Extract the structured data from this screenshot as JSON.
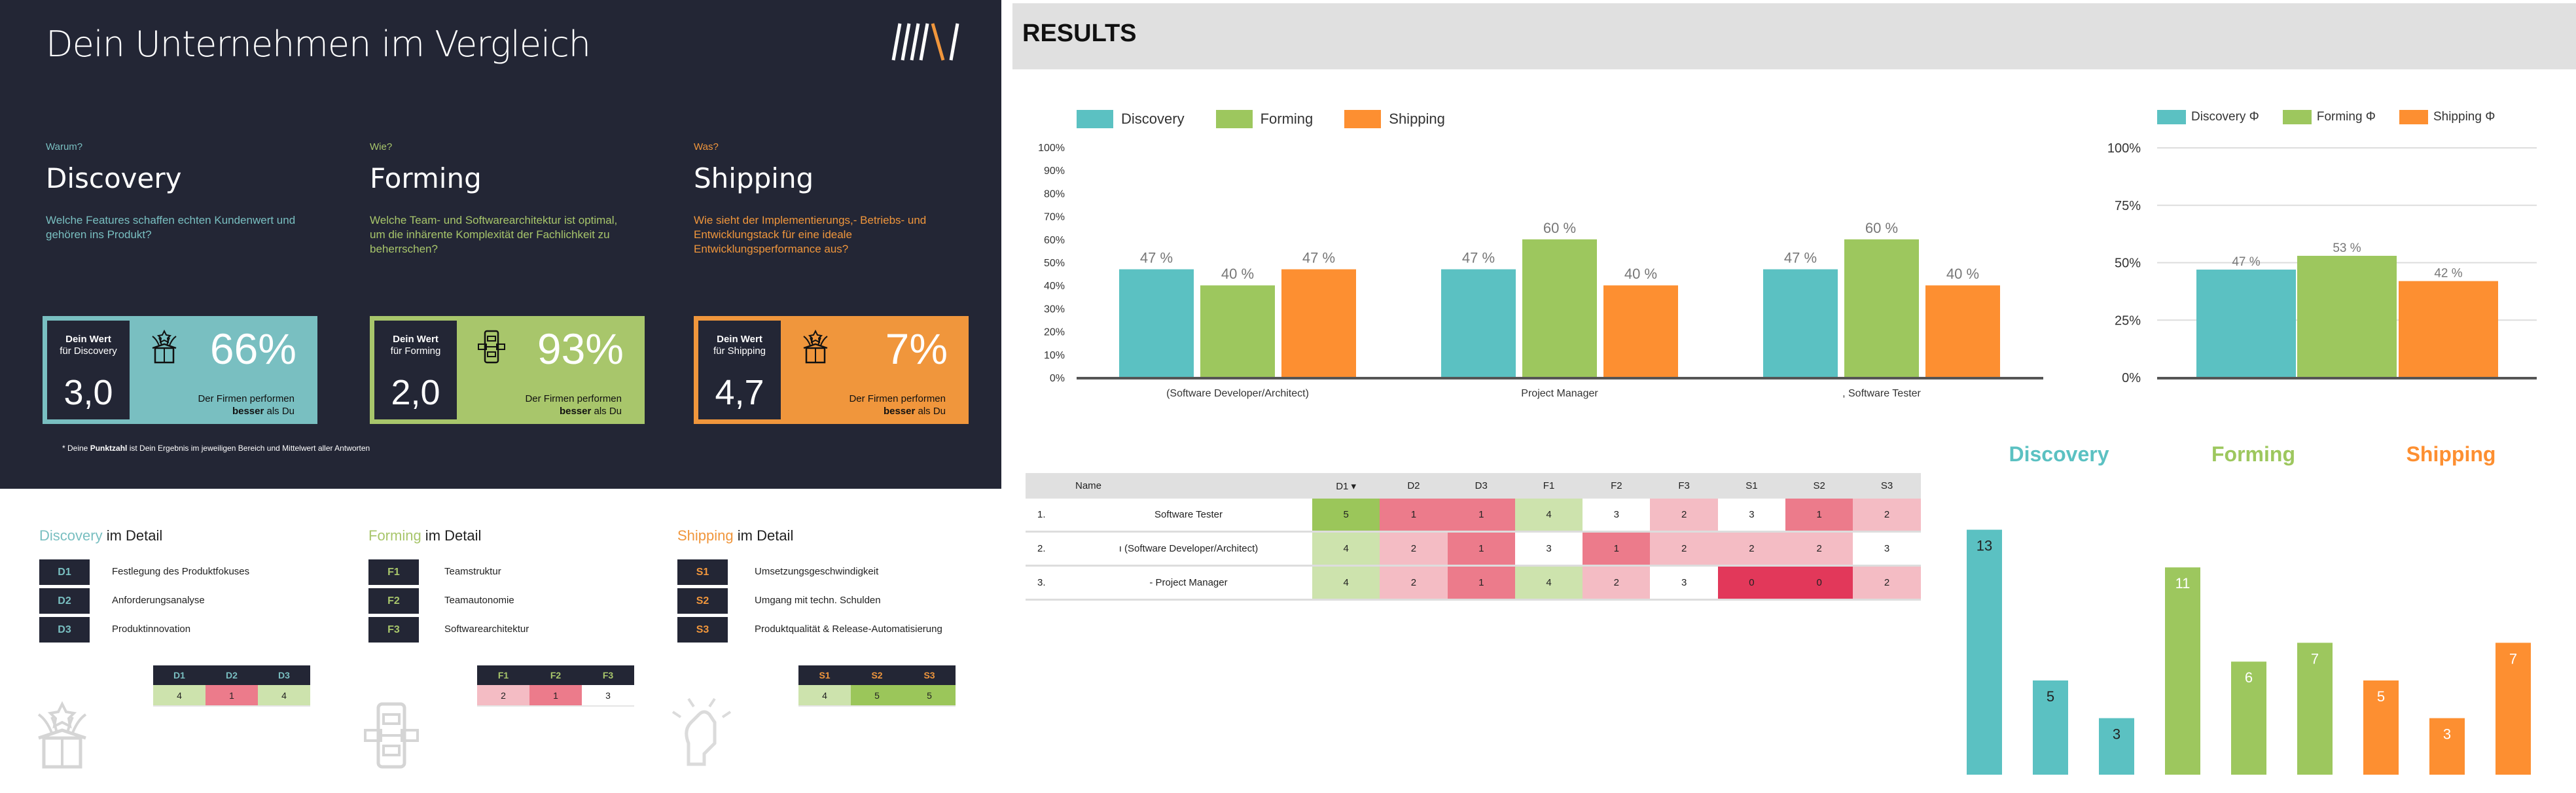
{
  "colors": {
    "discovery": "#5bc1c2",
    "forming": "#9dc75e",
    "shipping": "#fd8f31",
    "discovery_box": "#79bfc1",
    "forming_box": "#a8c66b",
    "shipping_box": "#f0963c",
    "dark": "#232635"
  },
  "left": {
    "title": "Dein Unternehmen im Vergleich",
    "logo_text": "///\\/",
    "sections": [
      {
        "question": "Warum?",
        "heading": "Discovery",
        "description": "Welche Features schaffen echten Kundenwert und gehören ins Produkt?",
        "box_label_1": "Dein Wert",
        "box_label_2": "für Discovery",
        "score": "3,0",
        "percent": "66%",
        "note_1": "Der Firmen performen",
        "note_bold": "besser",
        "note_2": " als Du",
        "icon": "gift-box-icon"
      },
      {
        "question": "Wie?",
        "heading": "Forming",
        "description": "Welche Team- und Softwarearchitektur ist optimal, um die inhärente Komplexität der Fachlichkeit zu beherrschen?",
        "box_label_1": "Dein Wert",
        "box_label_2": "für Forming",
        "score": "2,0",
        "percent": "93%",
        "note_1": "Der Firmen performen",
        "note_bold": "besser",
        "note_2": " als Du",
        "icon": "architecture-icon"
      },
      {
        "question": "Was?",
        "heading": "Shipping",
        "description": "Wie sieht der Implementierungs,- Betriebs- und Entwicklungstack für eine ideale Entwicklungsperformance aus?",
        "box_label_1": "Dein Wert",
        "box_label_2": "für Shipping",
        "score": "4,7",
        "percent": "7%",
        "note_1": "Der Firmen performen",
        "note_bold": "besser",
        "note_2": " als Du",
        "icon": "gift-box-icon"
      }
    ],
    "footnote": {
      "pre": "* Deine ",
      "bold": "Punktzahl",
      "post": " ist Dein Ergebnis im jeweiligen Bereich und Mittelwert aller Antworten"
    },
    "details": [
      {
        "name": "Discovery",
        "suffix": " im Detail",
        "items": [
          {
            "code": "D1",
            "label": "Festlegung des Produktfokuses"
          },
          {
            "code": "D2",
            "label": "Anforderungsanalyse"
          },
          {
            "code": "D3",
            "label": "Produktinnovation"
          }
        ],
        "mini": {
          "headers": [
            "D1",
            "D2",
            "D3"
          ],
          "values": [
            "4",
            "1",
            "4"
          ]
        }
      },
      {
        "name": "Forming",
        "suffix": " im Detail",
        "items": [
          {
            "code": "F1",
            "label": "Teamstruktur"
          },
          {
            "code": "F2",
            "label": "Teamautonomie"
          },
          {
            "code": "F3",
            "label": "Softwarearchitektur"
          }
        ],
        "mini": {
          "headers": [
            "F1",
            "F2",
            "F3"
          ],
          "values": [
            "2",
            "1",
            "3"
          ]
        }
      },
      {
        "name": "Shipping",
        "suffix": " im Detail",
        "items": [
          {
            "code": "S1",
            "label": "Umsetzungsgeschwindigkeit"
          },
          {
            "code": "S2",
            "label": "Umgang mit techn. Schulden"
          },
          {
            "code": "S3",
            "label": "Produktqualität & Release-Automatisierung"
          }
        ],
        "mini": {
          "headers": [
            "S1",
            "S2",
            "S3"
          ],
          "values": [
            "4",
            "5",
            "5"
          ]
        }
      }
    ]
  },
  "results": {
    "title": "RESULTS"
  },
  "score_colors": {
    "0": "#e2385a",
    "1": "#ec7b8b",
    "2": "#f4bcc4",
    "3": "#ffffff",
    "4": "#cde3ad",
    "5": "#9bc65a"
  },
  "chart_data": [
    {
      "type": "bar",
      "categories": [
        "(Software Developer/Architect)",
        "Project Manager",
        ", Software Tester"
      ],
      "series": [
        {
          "name": "Discovery",
          "values": [
            47,
            47,
            47
          ]
        },
        {
          "name": "Forming",
          "values": [
            40,
            60,
            60
          ]
        },
        {
          "name": "Shipping",
          "values": [
            47,
            40,
            40
          ]
        }
      ],
      "data_labels": [
        [
          "47 %",
          "47 %",
          "47 %"
        ],
        [
          "40 %",
          "60 %",
          "60 %"
        ],
        [
          "47 %",
          "40 %",
          "40 %"
        ]
      ],
      "yticks": [
        "0%",
        "10%",
        "20%",
        "30%",
        "40%",
        "50%",
        "60%",
        "70%",
        "80%",
        "90%",
        "100%"
      ],
      "ylim": [
        0,
        100
      ],
      "grid": false,
      "legend": "top-left"
    },
    {
      "type": "bar",
      "categories": [
        ""
      ],
      "series": [
        {
          "name": "Discovery Φ",
          "values": [
            47
          ]
        },
        {
          "name": "Forming Φ",
          "values": [
            53
          ]
        },
        {
          "name": "Shipping Φ",
          "values": [
            42
          ]
        }
      ],
      "data_labels": [
        "47 %",
        "53 %",
        "42 %"
      ],
      "yticks": [
        "0%",
        "25%",
        "50%",
        "75%",
        "100%"
      ],
      "ylim": [
        0,
        100
      ],
      "grid": true,
      "legend": "top"
    },
    {
      "type": "bar",
      "groups": [
        "Discovery",
        "Forming",
        "Shipping"
      ],
      "values": [
        13,
        5,
        3,
        11,
        6,
        7,
        5,
        3,
        7
      ],
      "value_labels": [
        "13",
        "5",
        "3",
        "11",
        "6",
        "7",
        "5",
        "3",
        "7"
      ],
      "ylim": [
        0,
        13
      ],
      "grid": false
    },
    {
      "type": "table",
      "columns": [
        "Name",
        "D1 ▾",
        "D2",
        "D3",
        "F1",
        "F2",
        "F3",
        "S1",
        "S2",
        "S3"
      ],
      "rows": [
        {
          "rank": "1.",
          "name": "Software Tester",
          "values": [
            "5",
            "1",
            "1",
            "4",
            "3",
            "2",
            "3",
            "1",
            "2"
          ]
        },
        {
          "rank": "2.",
          "name": "ı (Software Developer/Architect)",
          "values": [
            "4",
            "2",
            "1",
            "3",
            "1",
            "2",
            "2",
            "2",
            "3"
          ]
        },
        {
          "rank": "3.",
          "name": "- Project Manager",
          "values": [
            "4",
            "2",
            "1",
            "4",
            "2",
            "3",
            "0",
            "0",
            "2"
          ]
        }
      ]
    }
  ]
}
